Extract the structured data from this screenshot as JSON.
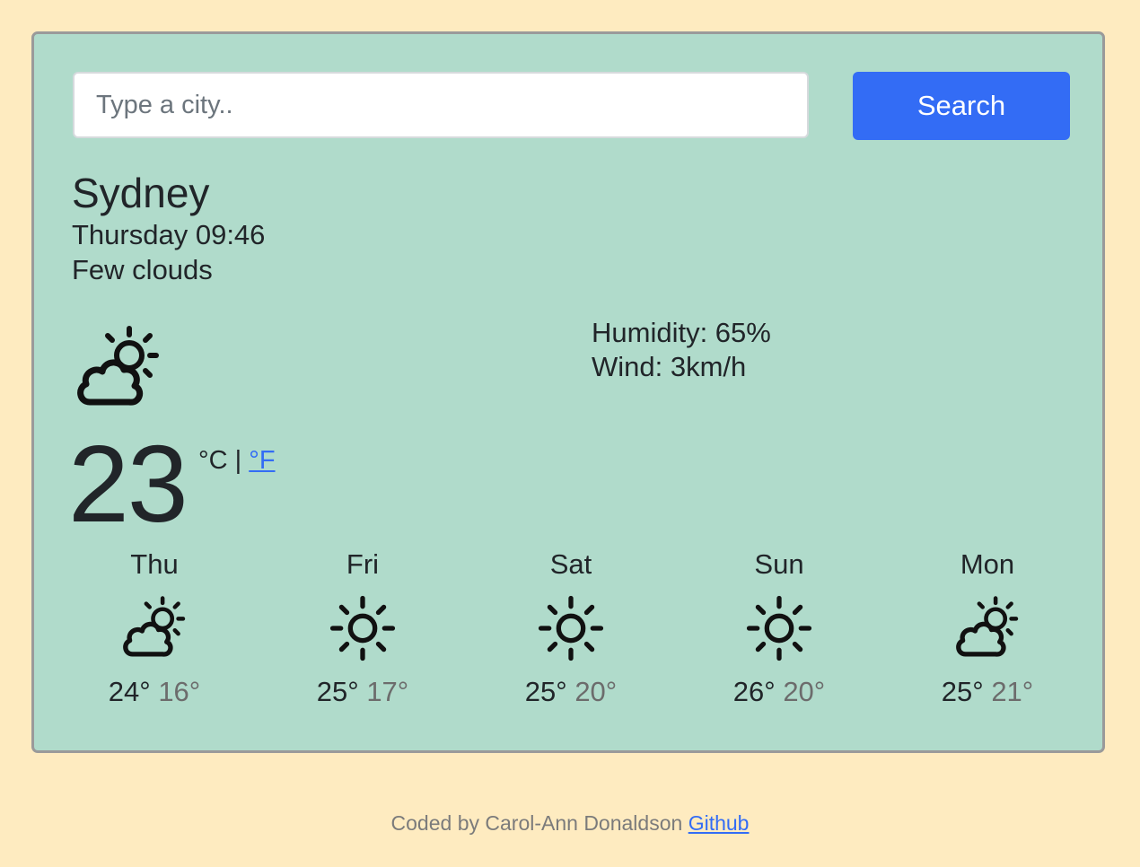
{
  "search": {
    "placeholder": "Type a city..",
    "value": "",
    "button_label": "Search"
  },
  "current": {
    "city": "Sydney",
    "datetime": "Thursday 09:46",
    "description": "Few clouds",
    "icon": "partly-cloudy-icon",
    "humidity": "Humidity: 65%",
    "wind": "Wind: 3km/h",
    "temperature": "23",
    "unit_celsius": "°C",
    "unit_separator": "|",
    "unit_fahrenheit": "°F"
  },
  "forecast": [
    {
      "day": "Thu",
      "icon": "partly-cloudy-icon",
      "max": "24°",
      "min": "16°"
    },
    {
      "day": "Fri",
      "icon": "sun-icon",
      "max": "25°",
      "min": "17°"
    },
    {
      "day": "Sat",
      "icon": "sun-icon",
      "max": "25°",
      "min": "20°"
    },
    {
      "day": "Sun",
      "icon": "sun-icon",
      "max": "26°",
      "min": "20°"
    },
    {
      "day": "Mon",
      "icon": "partly-cloudy-icon",
      "max": "25°",
      "min": "21°"
    }
  ],
  "footer": {
    "text": "Coded by Carol-Ann Donaldson",
    "link_label": "Github"
  },
  "colors": {
    "page_background": "#feebc0",
    "card_background": "#b0dbcb",
    "accent": "#336cf5"
  }
}
